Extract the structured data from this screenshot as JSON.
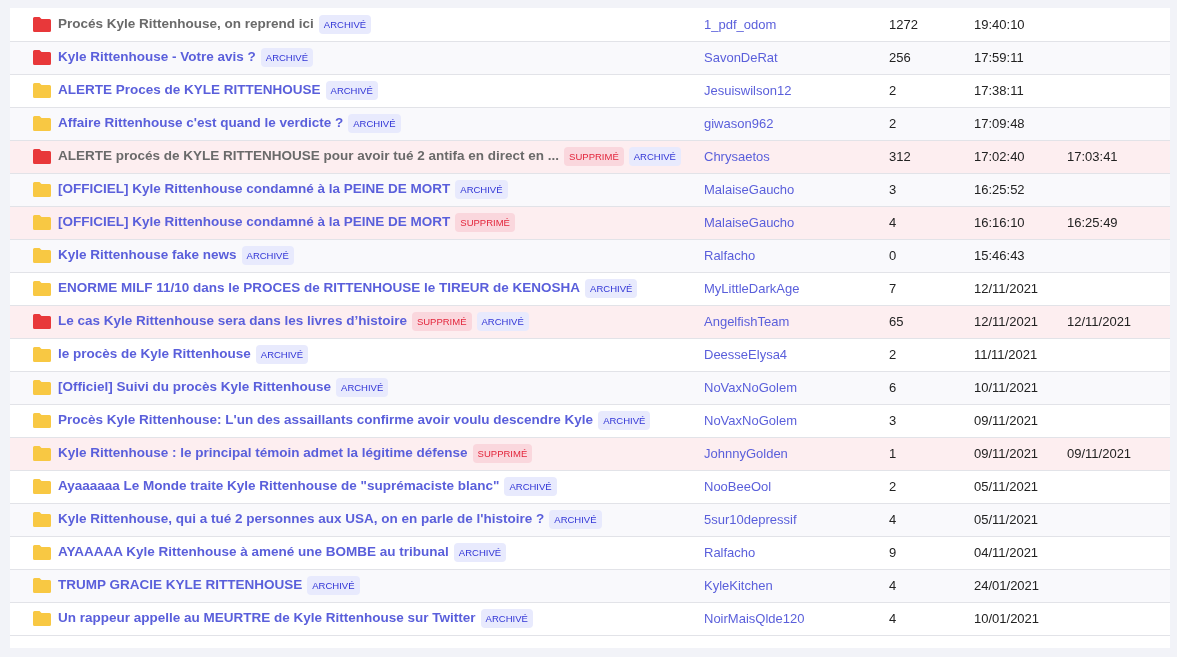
{
  "topics": [
    {
      "title": "Procés Kyle Rittenhouse, on reprend ici",
      "visited": true,
      "color": "#e8383a",
      "deleted": false,
      "tags": [
        {
          "kind": "archive",
          "label": "ARCHIVÉ"
        }
      ],
      "author": "1_pdf_odom",
      "count": "1272",
      "date": "19:40:10"
    },
    {
      "title": "Kyle Rittenhouse - Votre avis ?",
      "visited": false,
      "color": "#e8383a",
      "deleted": false,
      "tags": [
        {
          "kind": "archive",
          "label": "ARCHIVÉ"
        }
      ],
      "author": "SavonDeRat",
      "count": "256",
      "date": "17:59:11"
    },
    {
      "title": "ALERTE Proces de KYLE RITTENHOUSE",
      "visited": false,
      "color": "#f8c843",
      "deleted": false,
      "tags": [
        {
          "kind": "archive",
          "label": "ARCHIVÉ"
        }
      ],
      "author": "Jesuiswilson12",
      "count": "2",
      "date": "17:38:11"
    },
    {
      "title": "Affaire Rittenhouse c'est quand le verdicte ?",
      "visited": false,
      "color": "#f8c843",
      "deleted": false,
      "tags": [
        {
          "kind": "archive",
          "label": "ARCHIVÉ"
        }
      ],
      "author": "giwason962",
      "count": "2",
      "date": "17:09:48"
    },
    {
      "title": "ALERTE procés de KYLE RITTENHOUSE pour avoir tué 2 antifa en direct en ...",
      "visited": true,
      "color": "#e8383a",
      "deleted": true,
      "tags": [
        {
          "kind": "deleted",
          "label": "SUPPRIMÉ"
        },
        {
          "kind": "archive",
          "label": "ARCHIVÉ"
        }
      ],
      "author": "Chrysaetos",
      "count": "312",
      "date": "17:02:40",
      "deleted_date": "17:03:41"
    },
    {
      "title": "[OFFICIEL] Kyle Rittenhouse condamné à la PEINE DE MORT",
      "visited": false,
      "color": "#f8c843",
      "deleted": false,
      "tags": [
        {
          "kind": "archive",
          "label": "ARCHIVÉ"
        }
      ],
      "author": "MalaiseGaucho",
      "count": "3",
      "date": "16:25:52"
    },
    {
      "title": "[OFFICIEL] Kyle Rittenhouse condamné à la PEINE DE MORT",
      "visited": false,
      "color": "#f8c843",
      "deleted": true,
      "tags": [
        {
          "kind": "deleted",
          "label": "SUPPRIMÉ"
        }
      ],
      "author": "MalaiseGaucho",
      "count": "4",
      "date": "16:16:10",
      "deleted_date": "16:25:49"
    },
    {
      "title": "Kyle Rittenhouse fake news",
      "visited": false,
      "color": "#f8c843",
      "deleted": false,
      "tags": [
        {
          "kind": "archive",
          "label": "ARCHIVÉ"
        }
      ],
      "author": "Ralfacho",
      "count": "0",
      "date": "15:46:43"
    },
    {
      "title": "ENORME MILF 11/10 dans le PROCES de RITTENHOUSE le TIREUR de KENOSHA",
      "visited": false,
      "color": "#f8c843",
      "deleted": false,
      "tags": [
        {
          "kind": "archive",
          "label": "ARCHIVÉ"
        }
      ],
      "author": "MyLittleDarkAge",
      "count": "7",
      "date": "12/11/2021"
    },
    {
      "title": "Le cas Kyle Rittenhouse sera dans les livres d’histoire",
      "visited": false,
      "color": "#e8383a",
      "deleted": true,
      "tags": [
        {
          "kind": "deleted",
          "label": "SUPPRIMÉ"
        },
        {
          "kind": "archive",
          "label": "ARCHIVÉ"
        }
      ],
      "author": "AngelfishTeam",
      "count": "65",
      "date": "12/11/2021",
      "deleted_date": "12/11/2021"
    },
    {
      "title": "le procès de Kyle Rittenhouse",
      "visited": false,
      "color": "#f8c843",
      "deleted": false,
      "tags": [
        {
          "kind": "archive",
          "label": "ARCHIVÉ"
        }
      ],
      "author": "DeesseElysa4",
      "count": "2",
      "date": "11/11/2021"
    },
    {
      "title": "[Officiel] Suivi du procès Kyle Rittenhouse",
      "visited": false,
      "color": "#f8c843",
      "deleted": false,
      "tags": [
        {
          "kind": "archive",
          "label": "ARCHIVÉ"
        }
      ],
      "author": "NoVaxNoGolem",
      "count": "6",
      "date": "10/11/2021"
    },
    {
      "title": "Procès Kyle Rittenhouse: L'un des assaillants confirme avoir voulu descendre Kyle",
      "visited": false,
      "color": "#f8c843",
      "deleted": false,
      "tags": [
        {
          "kind": "archive",
          "label": "ARCHIVÉ"
        }
      ],
      "author": "NoVaxNoGolem",
      "count": "3",
      "date": "09/11/2021"
    },
    {
      "title": "Kyle Rittenhouse : le principal témoin admet la légitime défense",
      "visited": false,
      "color": "#f8c843",
      "deleted": true,
      "tags": [
        {
          "kind": "deleted",
          "label": "SUPPRIMÉ"
        }
      ],
      "author": "JohnnyGolden",
      "count": "1",
      "date": "09/11/2021",
      "deleted_date": "09/11/2021"
    },
    {
      "title": "Ayaaaaaa Le Monde traite Kyle Rittenhouse de \"suprémaciste blanc\"",
      "visited": false,
      "color": "#f8c843",
      "deleted": false,
      "tags": [
        {
          "kind": "archive",
          "label": "ARCHIVÉ"
        }
      ],
      "author": "NooBeeOol",
      "count": "2",
      "date": "05/11/2021"
    },
    {
      "title": "Kyle Rittenhouse, qui a tué 2 personnes aux USA, on en parle de l'histoire ?",
      "visited": false,
      "color": "#f8c843",
      "deleted": false,
      "tags": [
        {
          "kind": "archive",
          "label": "ARCHIVÉ"
        }
      ],
      "author": "5sur10depressif",
      "count": "4",
      "date": "05/11/2021"
    },
    {
      "title": "AYAAAAA Kyle Rittenhouse à amené une BOMBE au tribunal",
      "visited": false,
      "color": "#f8c843",
      "deleted": false,
      "tags": [
        {
          "kind": "archive",
          "label": "ARCHIVÉ"
        }
      ],
      "author": "Ralfacho",
      "count": "9",
      "date": "04/11/2021"
    },
    {
      "title": "TRUMP GRACIE KYLE RITTENHOUSE",
      "visited": false,
      "color": "#f8c843",
      "deleted": false,
      "tags": [
        {
          "kind": "archive",
          "label": "ARCHIVÉ"
        }
      ],
      "author": "KyleKitchen",
      "count": "4",
      "date": "24/01/2021"
    },
    {
      "title": "Un rappeur appelle au MEURTRE de Kyle Rittenhouse sur Twitter",
      "visited": false,
      "color": "#f8c843",
      "deleted": false,
      "tags": [
        {
          "kind": "archive",
          "label": "ARCHIVÉ"
        }
      ],
      "author": "NoirMaisQlde120",
      "count": "4",
      "date": "10/01/2021"
    }
  ]
}
